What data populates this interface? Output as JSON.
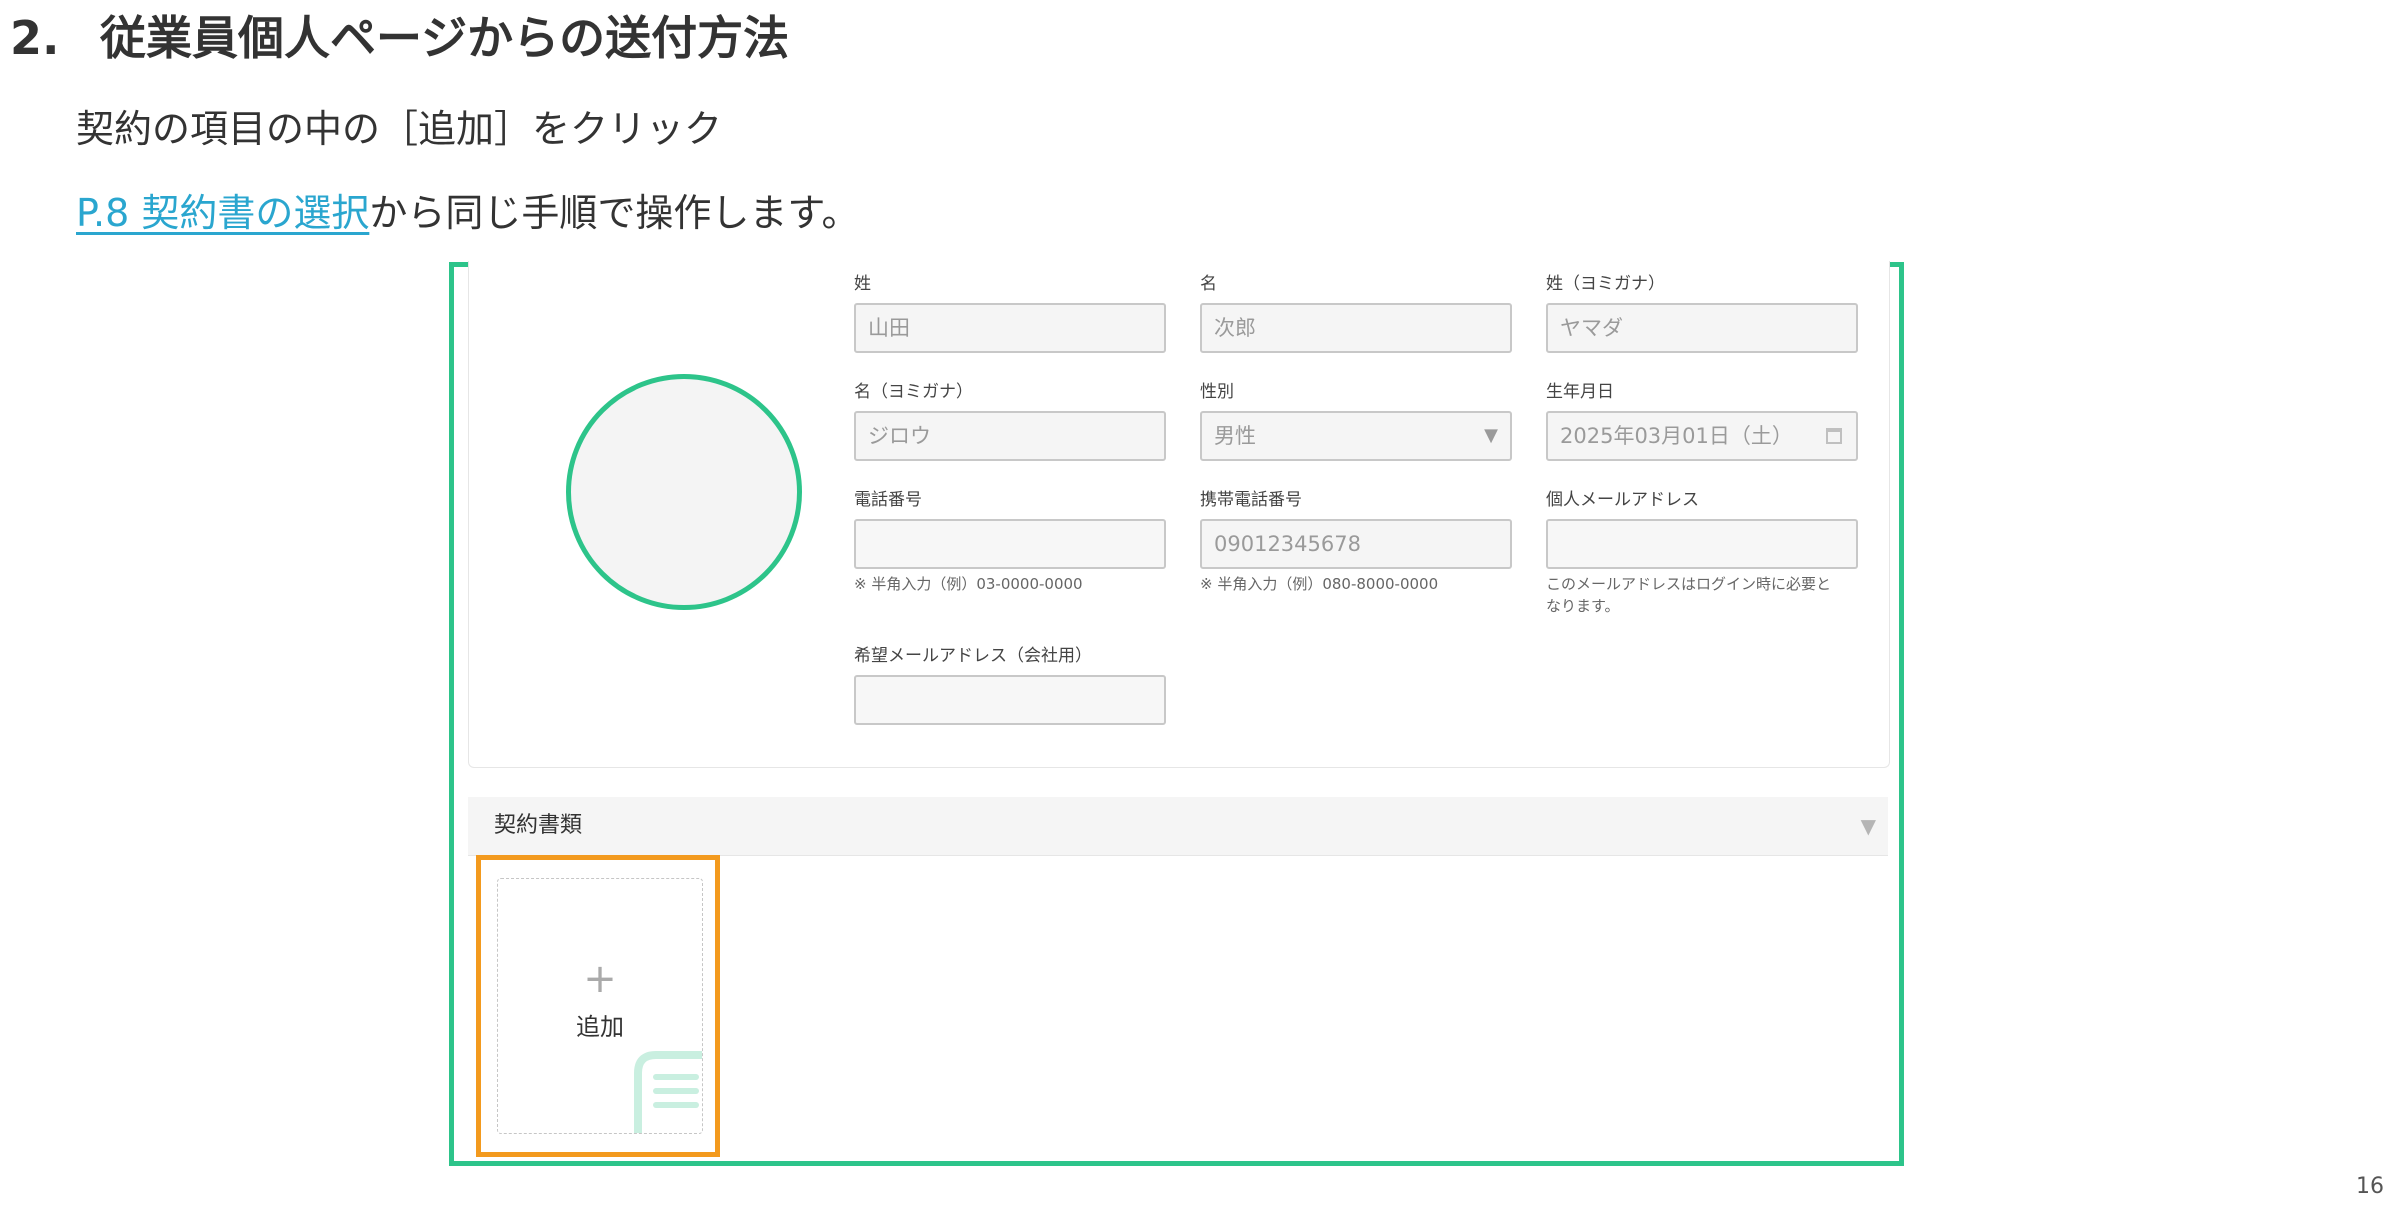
{
  "slide": {
    "section_number": "2.",
    "section_title": "従業員個人ページからの送付方法",
    "instruction": "契約の項目の中の［追加］をクリック",
    "link_text": "P.8 契約書の選択",
    "link_suffix": "から同じ手順で操作します。",
    "page_number": "16"
  },
  "colors": {
    "highlight_green": "#2dc48a",
    "highlight_orange": "#f39a1e",
    "link": "#2aa6cf"
  },
  "form": {
    "last_name": {
      "label": "姓",
      "value": "山田"
    },
    "first_name": {
      "label": "名",
      "value": "次郎"
    },
    "last_name_kana": {
      "label": "姓（ヨミガナ）",
      "value": "ヤマダ"
    },
    "first_name_kana": {
      "label": "名（ヨミガナ）",
      "value": "ジロウ"
    },
    "gender": {
      "label": "性別",
      "value": "男性",
      "icon": "chevron-down-icon"
    },
    "birthday": {
      "label": "生年月日",
      "value": "2025年03月01日（土）",
      "icon": "calendar-icon"
    },
    "phone": {
      "label": "電話番号",
      "value": "",
      "hint": "※ 半角入力（例）03-0000-0000"
    },
    "mobile": {
      "label": "携帯電話番号",
      "value": "09012345678",
      "hint": "※ 半角入力（例）080-8000-0000"
    },
    "personal_email": {
      "label": "個人メールアドレス",
      "value": "",
      "hint": "このメールアドレスはログイン時に必要と\nなります。"
    },
    "work_email": {
      "label": "希望メールアドレス（会社用）",
      "value": ""
    }
  },
  "contract_section": {
    "title": "契約書類",
    "chevron_icon": "chevron-down-icon",
    "add_icon": "plus-icon",
    "add_label": "追加",
    "document_icon": "document-icon"
  }
}
